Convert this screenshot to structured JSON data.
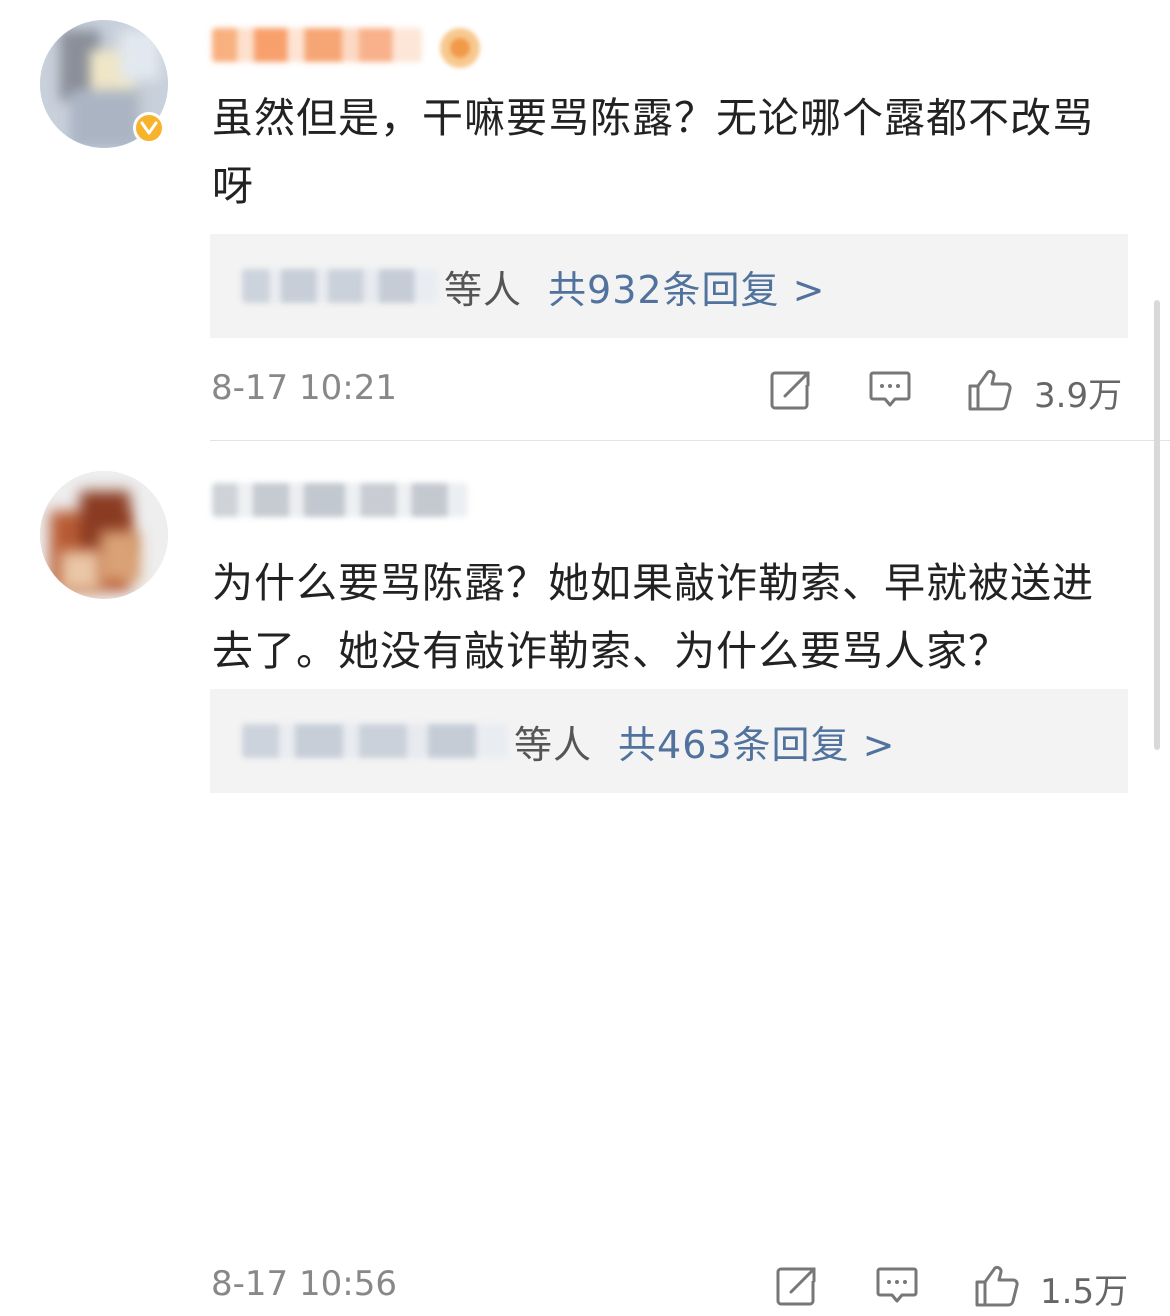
{
  "comments": [
    {
      "text": "虽然但是，干嘛要骂陈露？无论哪个露都不改骂呀",
      "reply_suffix": "等人",
      "reply_link": "共932条回复 >",
      "time": "8-17 10:21",
      "like_count": "3.9万",
      "verified": true
    },
    {
      "text": "为什么要骂陈露？她如果敲诈勒索、早就被送进去了。她没有敲诈勒索、为什么要骂人家？",
      "reply_suffix": "等人",
      "reply_link": "共463条回复 >",
      "time": "8-17 10:56",
      "like_count": "1.5万",
      "verified": false
    }
  ],
  "icons": {
    "share": "share-icon",
    "comment": "comment-icon",
    "like": "thumbs-up-icon",
    "verified": "verified-badge-icon"
  },
  "colors": {
    "reply_link": "#50729d",
    "verified_badge": "#f6b32b",
    "reply_box_bg": "#f3f3f3",
    "meta_text": "#888888"
  }
}
